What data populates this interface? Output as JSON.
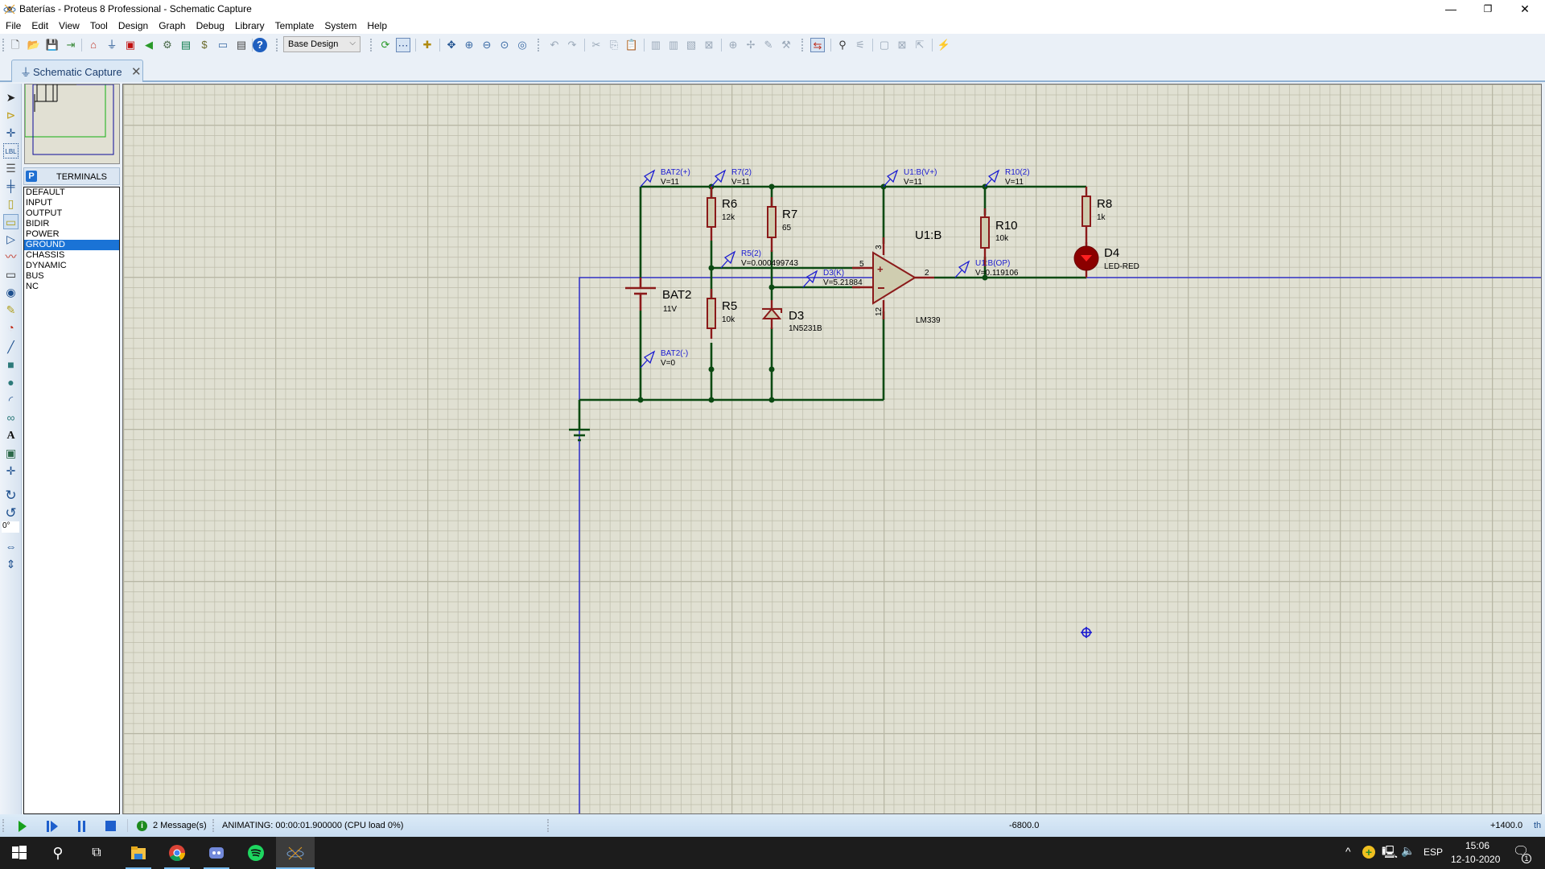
{
  "window": {
    "title": "Baterías - Proteus 8 Professional - Schematic Capture",
    "controls": {
      "minimize": "—",
      "restore": "❐",
      "close": "✕"
    }
  },
  "menu": [
    "File",
    "Edit",
    "View",
    "Tool",
    "Design",
    "Graph",
    "Debug",
    "Library",
    "Template",
    "System",
    "Help"
  ],
  "toolbar": {
    "design_select": "Base Design",
    "buttons": [
      "new-icon",
      "open-icon",
      "save-icon",
      "import-icon",
      "home-icon",
      "schematic-icon",
      "pcb-icon",
      "3d-icon",
      "gerber-icon",
      "vsm-studio-icon",
      "bom-icon",
      "design-notes-icon",
      "report-icon",
      "help-icon"
    ],
    "view_buttons": [
      "refresh-icon",
      "grid-icon",
      "origin-icon",
      "pan-icon",
      "zoom-in-icon",
      "zoom-out-icon",
      "zoom-all-icon",
      "zoom-area-icon",
      "undo-icon",
      "redo-icon",
      "cut-icon",
      "copy-icon",
      "paste-icon",
      "block-copy-icon",
      "block-move-icon",
      "block-rotate-icon",
      "block-delete-icon",
      "pick-device-icon",
      "make-device-icon",
      "packaging-icon",
      "decompose-icon",
      "wire-autorouter-icon",
      "search-icon",
      "property-tool-icon",
      "new-sheet-icon",
      "remove-sheet-icon",
      "exit-to-parent-icon",
      "netlist-icon"
    ]
  },
  "tabs": [
    {
      "label": "Schematic Capture",
      "close": "✕"
    }
  ],
  "left_toolbar": {
    "rotation": "0°"
  },
  "side_panel": {
    "mode_letter": "P",
    "title": "TERMINALS",
    "items": [
      "DEFAULT",
      "INPUT",
      "OUTPUT",
      "BIDIR",
      "POWER",
      "GROUND",
      "CHASSIS",
      "DYNAMIC",
      "BUS",
      "NC"
    ],
    "selected": "GROUND"
  },
  "schematic": {
    "components": {
      "bat2": {
        "ref": "BAT2",
        "value": "11V"
      },
      "r6": {
        "ref": "R6",
        "value": "12k"
      },
      "r7": {
        "ref": "R7",
        "value": "65"
      },
      "r5": {
        "ref": "R5",
        "value": "10k"
      },
      "d3": {
        "ref": "D3",
        "value": "1N5231B"
      },
      "u1": {
        "ref": "U1:B",
        "value": "LM339",
        "pin_plus": "5",
        "pin_out": "2",
        "pin_vplus": "3",
        "pin_gnd": "12"
      },
      "r10": {
        "ref": "R10",
        "value": "10k"
      },
      "r8": {
        "ref": "R8",
        "value": "1k"
      },
      "d4": {
        "ref": "D4",
        "value": "LED-RED"
      }
    },
    "probes": [
      {
        "name": "BAT2(+)",
        "value": "V=11"
      },
      {
        "name": "R7(2)",
        "value": "V=11"
      },
      {
        "name": "R5(2)",
        "value": "V=0.000499743"
      },
      {
        "name": "D3(K)",
        "value": "V=5.21884"
      },
      {
        "name": "BAT2(-)",
        "value": "V=0"
      },
      {
        "name": "U1:B(V+)",
        "value": "V=11"
      },
      {
        "name": "R10(2)",
        "value": "V=11"
      },
      {
        "name": "U1:B(OP)",
        "value": "V=0.119106"
      }
    ],
    "colors": {
      "wire": "#0b4a12",
      "component": "#8b1a1a",
      "body": "#cfcdb0",
      "probe": "#1b1bd1",
      "background": "#e0e0d2",
      "led": "#a30000"
    }
  },
  "status": {
    "messages": "2 Message(s)",
    "animation": "ANIMATING: 00:00:01.900000 (CPU load 0%)",
    "coord_x": "-6800.0",
    "coord_y": "+1400.0",
    "units": "th"
  },
  "taskbar": {
    "apps": [
      "start-icon",
      "search-icon",
      "task-view-icon",
      "file-explorer-icon",
      "chrome-icon",
      "discord-icon",
      "spotify-icon",
      "proteus-icon"
    ],
    "language": "ESP",
    "time": "15:06",
    "date": "12-10-2020",
    "notifications": "1"
  }
}
